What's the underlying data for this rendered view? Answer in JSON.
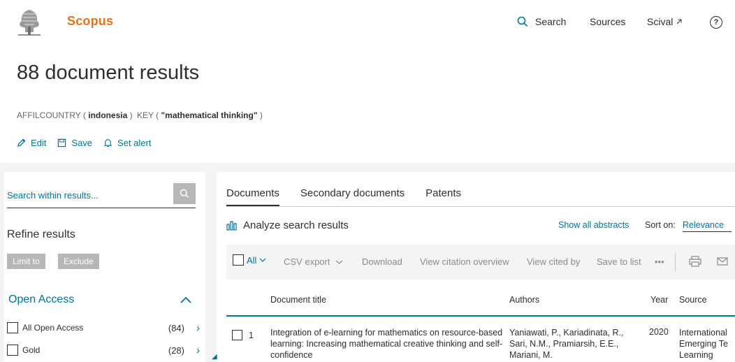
{
  "header": {
    "brand": "Scopus",
    "nav": {
      "search": "Search",
      "sources": "Sources",
      "scival": "Scival"
    },
    "help": "?"
  },
  "results": {
    "title": "88 document results",
    "query": {
      "field1": "AFFILCOUNTRY",
      "open1": "(",
      "value1": "indonesia",
      "close1": ")",
      "field2": "KEY",
      "open2": "(",
      "value2": "\"mathematical thinking\"",
      "close2": ")"
    },
    "actions": {
      "edit": "Edit",
      "save": "Save",
      "set_alert": "Set alert"
    }
  },
  "sidebar": {
    "search_placeholder": "Search within results...",
    "refine_title": "Refine results",
    "limit_to": "Limit to",
    "exclude": "Exclude",
    "facet": {
      "title": "Open Access",
      "items": [
        {
          "label": "All Open Access",
          "count": "(84)"
        },
        {
          "label": "Gold",
          "count": "(28)"
        }
      ]
    }
  },
  "main": {
    "tabs": [
      {
        "label": "Documents",
        "active": true
      },
      {
        "label": "Secondary documents",
        "active": false
      },
      {
        "label": "Patents",
        "active": false
      }
    ],
    "analyze": "Analyze search results",
    "show_all_abstracts": "Show all abstracts",
    "sort_label": "Sort on:",
    "sort_value": "Relevance",
    "toolbar": {
      "all": "All",
      "csv_export": "CSV export",
      "download": "Download",
      "view_citation_overview": "View citation overview",
      "view_cited_by": "View cited by",
      "save_to_list": "Save to list",
      "more": "•••"
    },
    "table": {
      "headers": {
        "title": "Document title",
        "authors": "Authors",
        "year": "Year",
        "source": "Source"
      },
      "rows": [
        {
          "num": "1",
          "title": "Integration of e-learning for mathematics on resource-based learning: Increasing mathematical creative thinking and self-confidence",
          "authors": "Yaniawati, P., Kariadinata, R., Sari, N.M., Pramiarsih, E.E., Mariani, M.",
          "year": "2020",
          "source_lines": [
            "International",
            "Emerging Te",
            "Learning"
          ]
        }
      ]
    }
  },
  "colors": {
    "brand": "#e9711c",
    "link": "#007398",
    "text": "#2e2e2e",
    "chip": "#b7b7b7"
  }
}
